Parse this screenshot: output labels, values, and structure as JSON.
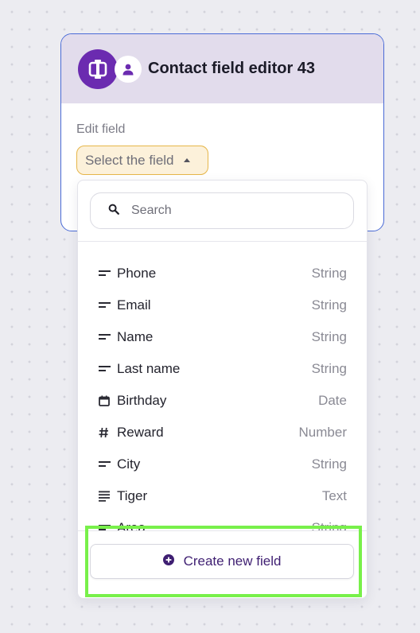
{
  "node": {
    "title": "Contact field editor 43",
    "edit_label": "Edit field",
    "select_placeholder": "Select the field"
  },
  "dropdown": {
    "search_placeholder": "Search",
    "fields": [
      {
        "icon": "text-lines-icon",
        "name": "Phone",
        "type": "String"
      },
      {
        "icon": "text-lines-icon",
        "name": "Email",
        "type": "String"
      },
      {
        "icon": "text-lines-icon",
        "name": "Name",
        "type": "String"
      },
      {
        "icon": "text-lines-icon",
        "name": "Last name",
        "type": "String"
      },
      {
        "icon": "calendar-icon",
        "name": "Birthday",
        "type": "Date"
      },
      {
        "icon": "hash-icon",
        "name": "Reward",
        "type": "Number"
      },
      {
        "icon": "text-lines-icon",
        "name": "City",
        "type": "String"
      },
      {
        "icon": "paragraph-icon",
        "name": "Tiger",
        "type": "Text"
      },
      {
        "icon": "text-lines-icon",
        "name": "Area",
        "type": "String"
      }
    ],
    "create_label": "Create new field"
  },
  "colors": {
    "brand_purple": "#6b2bb0",
    "header_bg": "#e2dcec",
    "card_border": "#4a6bd6",
    "select_border": "#e6b64a",
    "highlight": "#78f04a"
  }
}
